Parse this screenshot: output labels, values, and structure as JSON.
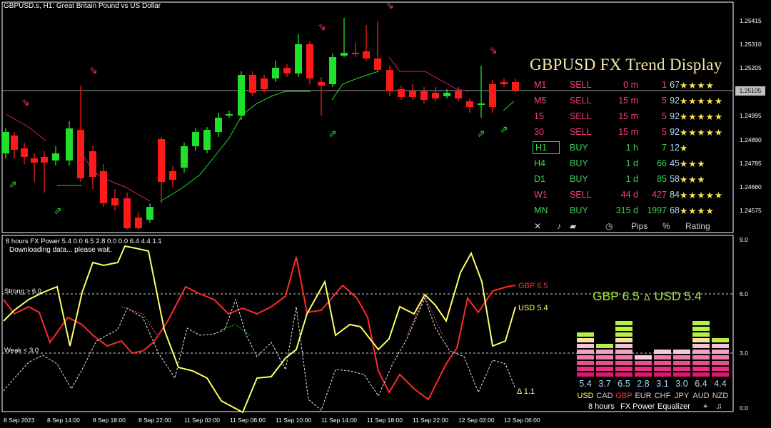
{
  "window": {
    "title": "GBPUSD.s, H1:  Great Britain Pound vs US Dollar",
    "current_price": "1.25105"
  },
  "price_axis": [
    "1.25415",
    "1.25310",
    "1.25205",
    "1.24995",
    "1.24890",
    "1.24785",
    "1.24680",
    "1.24575"
  ],
  "time_axis": [
    "8 Sep 2023",
    "8 Sep 14:00",
    "8 Sep 18:00",
    "8 Sep 22:00",
    "11 Sep 02:00",
    "11 Sep 06:00",
    "11 Sep 10:00",
    "11 Sep 14:00",
    "11 Sep 18:00",
    "11 Sep 22:00",
    "12 Sep 02:00",
    "12 Sep 06:00"
  ],
  "trend_display": {
    "title": "GBPUSD FX Trend Display",
    "rows": [
      {
        "tf": "M1",
        "action": "SELL",
        "duration": "0 m",
        "pips": "1",
        "rating": "67",
        "stars": "★★★★",
        "side": "sell"
      },
      {
        "tf": "M5",
        "action": "SELL",
        "duration": "15 m",
        "pips": "5",
        "rating": "92",
        "stars": "★★★★★",
        "side": "sell"
      },
      {
        "tf": "15",
        "action": "SELL",
        "duration": "15 m",
        "pips": "5",
        "rating": "92",
        "stars": "★★★★★",
        "side": "sell"
      },
      {
        "tf": "30",
        "action": "SELL",
        "duration": "15 m",
        "pips": "5",
        "rating": "92",
        "stars": "★★★★★",
        "side": "sell"
      },
      {
        "tf": "H1",
        "action": "BUY",
        "duration": "1 h",
        "pips": "7",
        "rating": "12",
        "stars": "★",
        "side": "buy"
      },
      {
        "tf": "H4",
        "action": "BUY",
        "duration": "1 d",
        "pips": "66",
        "rating": "45",
        "stars": "★★★",
        "side": "buy"
      },
      {
        "tf": "D1",
        "action": "BUY",
        "duration": "1 d",
        "pips": "85",
        "rating": "58",
        "stars": "★★★",
        "side": "buy"
      },
      {
        "tf": "W1",
        "action": "SELL",
        "duration": "44 d",
        "pips": "427",
        "rating": "84",
        "stars": "★★★★★",
        "side": "sell"
      },
      {
        "tf": "MN",
        "action": "BUY",
        "duration": "315 d",
        "pips": "1997",
        "rating": "68",
        "stars": "★★★★",
        "side": "buy"
      }
    ],
    "header": {
      "close": "✕",
      "sound": "♪",
      "pips": "Pips",
      "percent": "%",
      "rating": "Rating"
    }
  },
  "power_indicator": {
    "title": "8 hours FX Power 5.4 0.0 6.5 2.8 0.0 0.0 6.4 4.4 1.1",
    "status": "Downloading data... please wait.",
    "strong_label": "Strong > 6.0",
    "weak_label": "Weak < 3.0",
    "axis": [
      "9.0",
      "6.0",
      "3.0",
      "0.0"
    ],
    "gbp_line_label": "GBP 6.5",
    "usd_line_label": "USD 5.4",
    "delta_line_label": "Δ 1.1",
    "headline_left": "GBP 6.5",
    "headline_delta": "Δ",
    "headline_right": "USD 5.4",
    "footer": {
      "period": "8 hours",
      "name": "FX Power",
      "equalizer": "Equalizer"
    },
    "currencies": [
      {
        "name": "USD",
        "value": "5.4",
        "strength": 5.4,
        "highlight": "usd"
      },
      {
        "name": "CAD",
        "value": "3.7",
        "strength": 3.7
      },
      {
        "name": "GBP",
        "value": "6.5",
        "strength": 6.5,
        "highlight": "gbp"
      },
      {
        "name": "EUR",
        "value": "2.8",
        "strength": 2.8
      },
      {
        "name": "CHF",
        "value": "3.1",
        "strength": 3.1
      },
      {
        "name": "JPY",
        "value": "3.0",
        "strength": 3.0
      },
      {
        "name": "AUD",
        "value": "6.4",
        "strength": 6.4
      },
      {
        "name": "NZD",
        "value": "4.4",
        "strength": 4.4
      }
    ]
  },
  "colors": {
    "bull": "#1fe02a",
    "bear": "#ff1a1a",
    "sell": "#ff3b8a",
    "buy": "#39d353",
    "gbp_line": "#ff2a2a",
    "usd_line": "#ffff66",
    "stars": "#ffe44a",
    "title_text": "#f4e8a8",
    "headline": "#9ee23e"
  }
}
